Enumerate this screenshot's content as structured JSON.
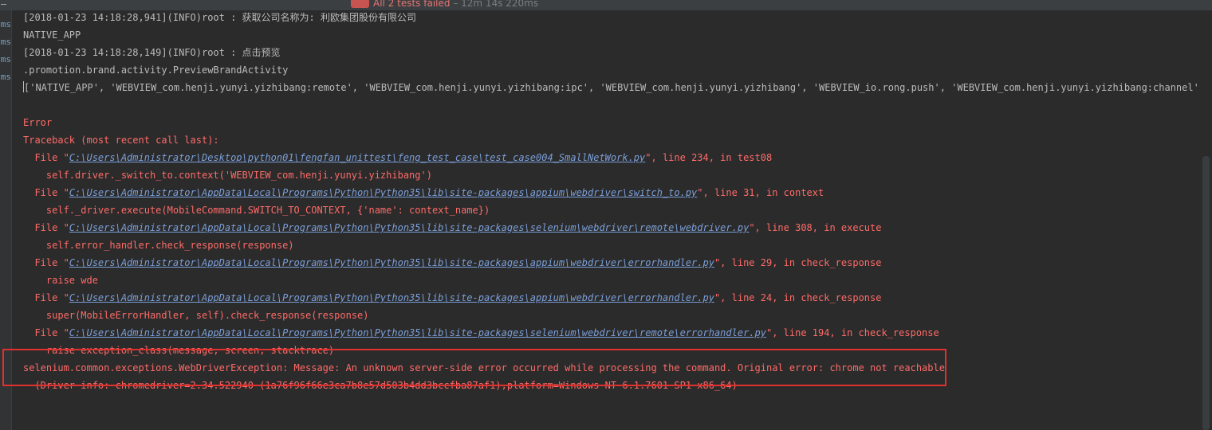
{
  "status_bar": {
    "result": "All 2 tests failed",
    "separator": "–",
    "elapsed": "12m 14s 220ms",
    "progress_fraction": 1.0
  },
  "gutter": {
    "label": "ms"
  },
  "console": {
    "lines": [
      {
        "text": "[2018-01-23 14:18:28,941](INFO)root : 获取公司名称为: 利欧集团股份有限公司",
        "kind": "out"
      },
      {
        "text": "NATIVE_APP",
        "kind": "out"
      },
      {
        "text": "[2018-01-23 14:18:28,149](INFO)root : 点击预览",
        "kind": "out"
      },
      {
        "text": ".promotion.brand.activity.PreviewBrandActivity",
        "kind": "out"
      },
      {
        "text": "['NATIVE_APP', 'WEBVIEW_com.henji.yunyi.yizhibang:remote', 'WEBVIEW_com.henji.yunyi.yizhibang:ipc', 'WEBVIEW_com.henji.yunyi.yizhibang', 'WEBVIEW_io.rong.push', 'WEBVIEW_com.henji.yunyi.yizhibang:channel']",
        "kind": "out"
      },
      {
        "text": "",
        "kind": "out"
      },
      {
        "text": "Error",
        "kind": "err"
      },
      {
        "text": "Traceback (most recent call last):",
        "kind": "err"
      },
      {
        "prefix": "  File \"",
        "link": "C:\\Users\\Administrator\\Desktop\\python01\\fengfan_unittest\\feng_test_case\\test_case004_SmallNetWork.py",
        "suffix": "\", line 234, in test08",
        "kind": "err"
      },
      {
        "text": "    self.driver._switch_to.context('WEBVIEW_com.henji.yunyi.yizhibang')",
        "kind": "err"
      },
      {
        "prefix": "  File \"",
        "link": "C:\\Users\\Administrator\\AppData\\Local\\Programs\\Python\\Python35\\lib\\site-packages\\appium\\webdriver\\switch_to.py",
        "suffix": "\", line 31, in context",
        "kind": "err"
      },
      {
        "text": "    self._driver.execute(MobileCommand.SWITCH_TO_CONTEXT, {'name': context_name})",
        "kind": "err"
      },
      {
        "prefix": "  File \"",
        "link": "C:\\Users\\Administrator\\AppData\\Local\\Programs\\Python\\Python35\\lib\\site-packages\\selenium\\webdriver\\remote\\webdriver.py",
        "suffix": "\", line 308, in execute",
        "kind": "err"
      },
      {
        "text": "    self.error_handler.check_response(response)",
        "kind": "err"
      },
      {
        "prefix": "  File \"",
        "link": "C:\\Users\\Administrator\\AppData\\Local\\Programs\\Python\\Python35\\lib\\site-packages\\appium\\webdriver\\errorhandler.py",
        "suffix": "\", line 29, in check_response",
        "kind": "err"
      },
      {
        "text": "    raise wde",
        "kind": "err"
      },
      {
        "prefix": "  File \"",
        "link": "C:\\Users\\Administrator\\AppData\\Local\\Programs\\Python\\Python35\\lib\\site-packages\\appium\\webdriver\\errorhandler.py",
        "suffix": "\", line 24, in check_response",
        "kind": "err"
      },
      {
        "text": "    super(MobileErrorHandler, self).check_response(response)",
        "kind": "err"
      },
      {
        "prefix": "  File \"",
        "link": "C:\\Users\\Administrator\\AppData\\Local\\Programs\\Python\\Python35\\lib\\site-packages\\selenium\\webdriver\\remote\\errorhandler.py",
        "suffix": "\", line 194, in check_response",
        "kind": "err"
      },
      {
        "text": "    raise exception_class(message, screen, stacktrace)",
        "kind": "err"
      },
      {
        "text": "selenium.common.exceptions.WebDriverException: Message: An unknown server-side error occurred while processing the command. Original error: chrome not reachable",
        "kind": "err"
      },
      {
        "text": "  (Driver info: chromedriver=2.34.522940 (1a76f96f66e3ca7b8e57d503b4dd3bccfba87af1),platform=Windows NT 6.1.7601 SP1 x86_64)",
        "kind": "err"
      }
    ]
  },
  "colors": {
    "background": "#2b2b2b",
    "stdout": "#bbbbbb",
    "stderr": "#ff6b68",
    "link": "#7b9fd9",
    "failed_status": "#e57373",
    "highlight_box": "#e0312f"
  }
}
